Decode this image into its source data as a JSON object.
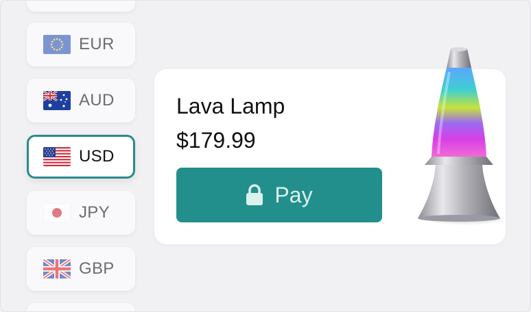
{
  "currencies": [
    {
      "code": "",
      "flag": "none",
      "state": "partial-top"
    },
    {
      "code": "EUR",
      "flag": "eu-flag-icon",
      "state": "default"
    },
    {
      "code": "AUD",
      "flag": "au-flag-icon",
      "state": "default"
    },
    {
      "code": "USD",
      "flag": "us-flag-icon",
      "state": "selected"
    },
    {
      "code": "JPY",
      "flag": "jp-flag-icon",
      "state": "default"
    },
    {
      "code": "GBP",
      "flag": "gb-flag-icon",
      "state": "default"
    },
    {
      "code": "",
      "flag": "none",
      "state": "partial-bottom"
    }
  ],
  "product": {
    "name": "Lava Lamp",
    "price": "$179.99",
    "image": "lava-lamp-image"
  },
  "pay_button": {
    "label": "Pay",
    "icon": "lock-icon"
  },
  "colors": {
    "accent": "#238f8c",
    "selected_border": "#2a8a8a",
    "background": "#f1f1f4",
    "card": "#ffffff"
  }
}
